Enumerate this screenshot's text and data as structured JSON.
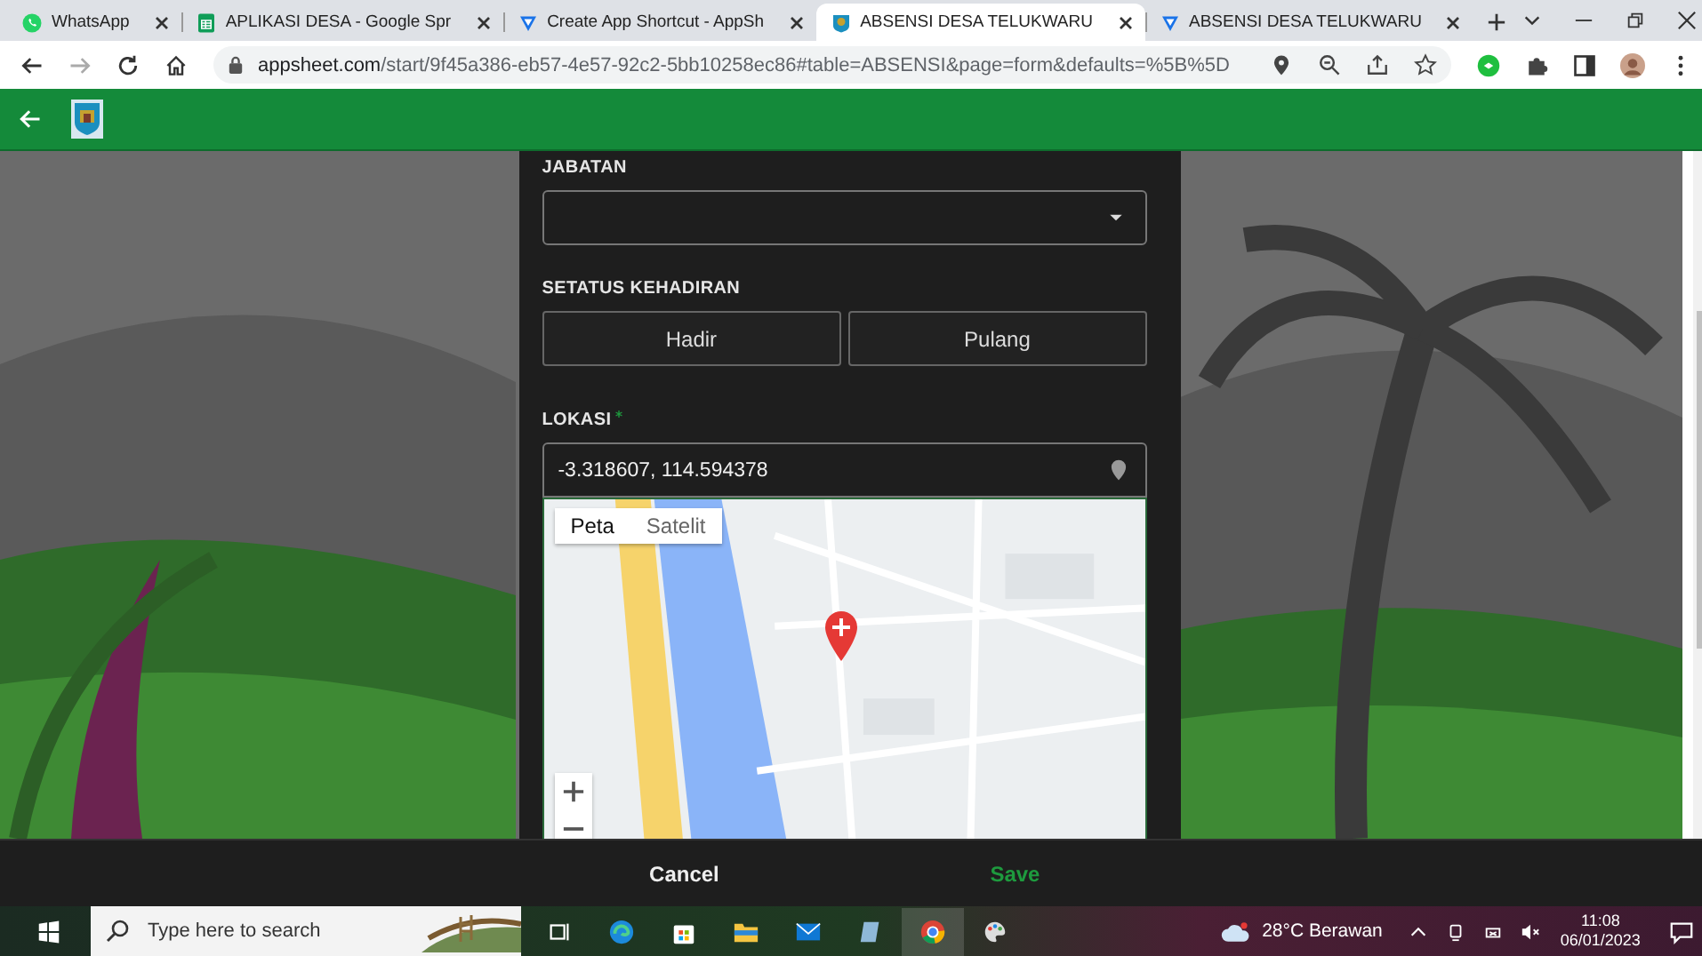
{
  "browser": {
    "tabs": [
      {
        "kind": "whatsapp",
        "title": "WhatsApp",
        "selected": false
      },
      {
        "kind": "sheets",
        "title": "APLIKASI DESA - Google Spr",
        "selected": false
      },
      {
        "kind": "appsheet",
        "title": "Create App Shortcut - AppSh",
        "selected": false
      },
      {
        "kind": "emblem",
        "title": "ABSENSI DESA TELUKWARU",
        "selected": true
      },
      {
        "kind": "appsheet",
        "title": "ABSENSI DESA TELUKWARU",
        "selected": false
      }
    ],
    "forward_disabled": true,
    "url": {
      "host": "appsheet.com",
      "path": "/start/9f45a386-eb57-4e57-92c2-5bb10258ec86#table=ABSENSI&page=form&defaults=%5B%5D"
    }
  },
  "form": {
    "fields": [
      {
        "kind": "dropdown",
        "label": "JABATAN"
      },
      {
        "kind": "choice",
        "label": "SETATUS KEHADIRAN",
        "options": [
          {
            "label": "Hadir",
            "selected": false
          },
          {
            "label": "Pulang",
            "selected": false
          }
        ]
      },
      {
        "kind": "location",
        "label": "LOKASI",
        "required": true,
        "value": "-3.318607, 114.594378",
        "map_types": [
          {
            "label": "Peta",
            "selected": true
          },
          {
            "label": "Satelit",
            "selected": false
          }
        ]
      }
    ]
  },
  "actions": {
    "cancel": "Cancel",
    "save": "Save"
  },
  "taskbar": {
    "search": {
      "placeholder": "Type here to search"
    },
    "weather": "28°C Berawan",
    "time": "11:08",
    "date": "06/01/2023"
  }
}
